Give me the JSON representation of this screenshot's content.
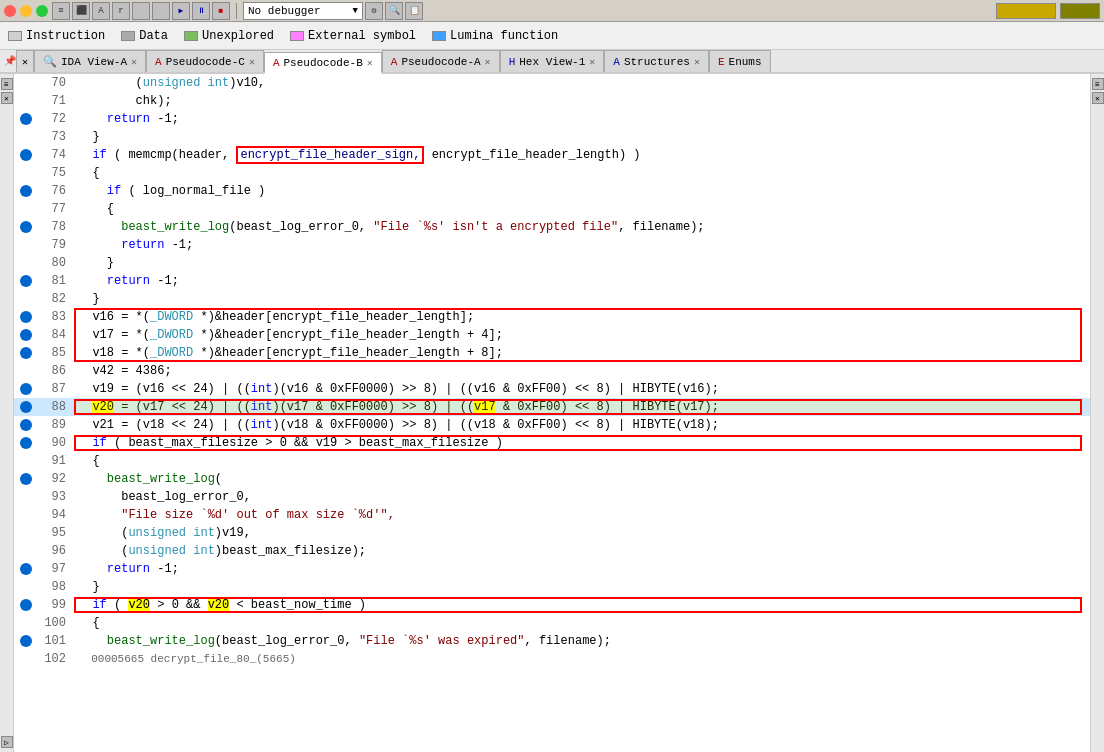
{
  "topbar": {
    "traffic_lights": [
      "close",
      "minimize",
      "maximize"
    ],
    "dropdown_text": "No debugger",
    "right_btn1": "",
    "right_btn2": ""
  },
  "legend": {
    "items": [
      {
        "label": "Instruction",
        "color": "#d0d0d0"
      },
      {
        "label": "Data",
        "color": "#aaaaaa"
      },
      {
        "label": "Unexplored",
        "color": "#7dbd5f"
      },
      {
        "label": "External symbol",
        "color": "#ff80ff"
      },
      {
        "label": "Lumina function",
        "color": "#40a0ff"
      }
    ]
  },
  "tabs": [
    {
      "label": "IDA View-A",
      "active": false,
      "closable": true
    },
    {
      "label": "Pseudocode-C",
      "active": false,
      "closable": true
    },
    {
      "label": "Pseudocode-B",
      "active": true,
      "closable": true
    },
    {
      "label": "Pseudocode-A",
      "active": false,
      "closable": true
    },
    {
      "label": "Hex View-1",
      "active": false,
      "closable": true
    },
    {
      "label": "Structures",
      "active": false,
      "closable": true
    },
    {
      "label": "Enums",
      "active": false,
      "closable": false
    }
  ],
  "code": {
    "lines": [
      {
        "num": 70,
        "bp": false,
        "content": "        (unsigned int)v10,"
      },
      {
        "num": 71,
        "bp": false,
        "content": "        chk);"
      },
      {
        "num": 72,
        "bp": true,
        "content": "    return -1;"
      },
      {
        "num": 73,
        "bp": false,
        "content": "  }"
      },
      {
        "num": 74,
        "bp": true,
        "content": "  if ( memcmp(header, encrypt_file_header_sign, encrypt_file_header_length) )"
      },
      {
        "num": 75,
        "bp": false,
        "content": "  {"
      },
      {
        "num": 76,
        "bp": true,
        "content": "    if ( log_normal_file )"
      },
      {
        "num": 77,
        "bp": false,
        "content": "    {"
      },
      {
        "num": 78,
        "bp": true,
        "content": "      beast_write_log(beast_log_error_0, \"File `%s' isn't a encrypted file\", filename);"
      },
      {
        "num": 79,
        "bp": false,
        "content": "      return -1;"
      },
      {
        "num": 80,
        "bp": false,
        "content": "    }"
      },
      {
        "num": 81,
        "bp": true,
        "content": "    return -1;"
      },
      {
        "num": 82,
        "bp": false,
        "content": "  }"
      },
      {
        "num": 83,
        "bp": true,
        "content": "  v16 = *(_DWORD *)&header[encrypt_file_header_length];"
      },
      {
        "num": 84,
        "bp": true,
        "content": "  v17 = *(_DWORD *)&header[encrypt_file_header_length + 4];"
      },
      {
        "num": 85,
        "bp": true,
        "content": "  v18 = *(_DWORD *)&header[encrypt_file_header_length + 8];"
      },
      {
        "num": 86,
        "bp": false,
        "content": "  v42 = 4386;"
      },
      {
        "num": 87,
        "bp": true,
        "content": "  v19 = (v16 << 24) | ((int)(v16 & 0xFF0000) >> 8) | ((v16 & 0xFF00) << 8) | HIBYTE(v16);"
      },
      {
        "num": 88,
        "bp": true,
        "content": "  v20 = (v17 << 24) | ((int)(v17 & 0xFF0000) >> 8) | ((v17 & 0xFF00) << 8) | HIBYTE(v17);"
      },
      {
        "num": 89,
        "bp": true,
        "content": "  v21 = (v18 << 24) | ((int)(v18 & 0xFF0000) >> 8) | ((v18 & 0xFF00) << 8) | HIBYTE(v18);"
      },
      {
        "num": 90,
        "bp": true,
        "content": "  if ( beast_max_filesize > 0 && v19 > beast_max_filesize )"
      },
      {
        "num": 91,
        "bp": false,
        "content": "  {"
      },
      {
        "num": 92,
        "bp": true,
        "content": "    beast_write_log("
      },
      {
        "num": 93,
        "bp": false,
        "content": "      beast_log_error_0,"
      },
      {
        "num": 94,
        "bp": false,
        "content": "      \"File size `%d' out of max size `%d'\","
      },
      {
        "num": 95,
        "bp": false,
        "content": "      (unsigned int)v19,"
      },
      {
        "num": 96,
        "bp": false,
        "content": "      (unsigned int)beast_max_filesize);"
      },
      {
        "num": 97,
        "bp": true,
        "content": "    return -1;"
      },
      {
        "num": 98,
        "bp": false,
        "content": "  }"
      },
      {
        "num": 99,
        "bp": true,
        "content": "  if ( v20 > 0 && v20 < beast_now_time )"
      },
      {
        "num": 100,
        "bp": false,
        "content": "  {"
      },
      {
        "num": 101,
        "bp": true,
        "content": "    beast_write_log(beast_log_error_0, \"File `%s' was expired\", filename);"
      },
      {
        "num": 102,
        "bp": false,
        "content": "  00005665 decrypt_file_80_(5665)"
      }
    ]
  }
}
